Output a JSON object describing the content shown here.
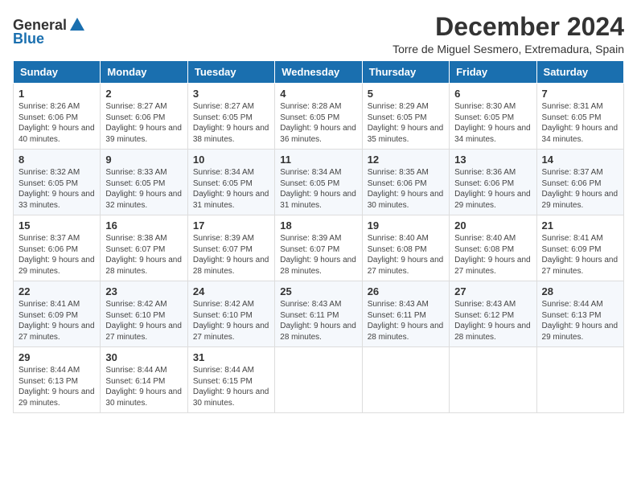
{
  "logo": {
    "general": "General",
    "blue": "Blue"
  },
  "title": {
    "month": "December 2024",
    "location": "Torre de Miguel Sesmero, Extremadura, Spain"
  },
  "headers": [
    "Sunday",
    "Monday",
    "Tuesday",
    "Wednesday",
    "Thursday",
    "Friday",
    "Saturday"
  ],
  "weeks": [
    [
      {
        "day": "1",
        "sunrise": "8:26 AM",
        "sunset": "6:06 PM",
        "daylight": "9 hours and 40 minutes."
      },
      {
        "day": "2",
        "sunrise": "8:27 AM",
        "sunset": "6:06 PM",
        "daylight": "9 hours and 39 minutes."
      },
      {
        "day": "3",
        "sunrise": "8:27 AM",
        "sunset": "6:05 PM",
        "daylight": "9 hours and 38 minutes."
      },
      {
        "day": "4",
        "sunrise": "8:28 AM",
        "sunset": "6:05 PM",
        "daylight": "9 hours and 36 minutes."
      },
      {
        "day": "5",
        "sunrise": "8:29 AM",
        "sunset": "6:05 PM",
        "daylight": "9 hours and 35 minutes."
      },
      {
        "day": "6",
        "sunrise": "8:30 AM",
        "sunset": "6:05 PM",
        "daylight": "9 hours and 34 minutes."
      },
      {
        "day": "7",
        "sunrise": "8:31 AM",
        "sunset": "6:05 PM",
        "daylight": "9 hours and 34 minutes."
      }
    ],
    [
      {
        "day": "8",
        "sunrise": "8:32 AM",
        "sunset": "6:05 PM",
        "daylight": "9 hours and 33 minutes."
      },
      {
        "day": "9",
        "sunrise": "8:33 AM",
        "sunset": "6:05 PM",
        "daylight": "9 hours and 32 minutes."
      },
      {
        "day": "10",
        "sunrise": "8:34 AM",
        "sunset": "6:05 PM",
        "daylight": "9 hours and 31 minutes."
      },
      {
        "day": "11",
        "sunrise": "8:34 AM",
        "sunset": "6:05 PM",
        "daylight": "9 hours and 31 minutes."
      },
      {
        "day": "12",
        "sunrise": "8:35 AM",
        "sunset": "6:06 PM",
        "daylight": "9 hours and 30 minutes."
      },
      {
        "day": "13",
        "sunrise": "8:36 AM",
        "sunset": "6:06 PM",
        "daylight": "9 hours and 29 minutes."
      },
      {
        "day": "14",
        "sunrise": "8:37 AM",
        "sunset": "6:06 PM",
        "daylight": "9 hours and 29 minutes."
      }
    ],
    [
      {
        "day": "15",
        "sunrise": "8:37 AM",
        "sunset": "6:06 PM",
        "daylight": "9 hours and 29 minutes."
      },
      {
        "day": "16",
        "sunrise": "8:38 AM",
        "sunset": "6:07 PM",
        "daylight": "9 hours and 28 minutes."
      },
      {
        "day": "17",
        "sunrise": "8:39 AM",
        "sunset": "6:07 PM",
        "daylight": "9 hours and 28 minutes."
      },
      {
        "day": "18",
        "sunrise": "8:39 AM",
        "sunset": "6:07 PM",
        "daylight": "9 hours and 28 minutes."
      },
      {
        "day": "19",
        "sunrise": "8:40 AM",
        "sunset": "6:08 PM",
        "daylight": "9 hours and 27 minutes."
      },
      {
        "day": "20",
        "sunrise": "8:40 AM",
        "sunset": "6:08 PM",
        "daylight": "9 hours and 27 minutes."
      },
      {
        "day": "21",
        "sunrise": "8:41 AM",
        "sunset": "6:09 PM",
        "daylight": "9 hours and 27 minutes."
      }
    ],
    [
      {
        "day": "22",
        "sunrise": "8:41 AM",
        "sunset": "6:09 PM",
        "daylight": "9 hours and 27 minutes."
      },
      {
        "day": "23",
        "sunrise": "8:42 AM",
        "sunset": "6:10 PM",
        "daylight": "9 hours and 27 minutes."
      },
      {
        "day": "24",
        "sunrise": "8:42 AM",
        "sunset": "6:10 PM",
        "daylight": "9 hours and 27 minutes."
      },
      {
        "day": "25",
        "sunrise": "8:43 AM",
        "sunset": "6:11 PM",
        "daylight": "9 hours and 28 minutes."
      },
      {
        "day": "26",
        "sunrise": "8:43 AM",
        "sunset": "6:11 PM",
        "daylight": "9 hours and 28 minutes."
      },
      {
        "day": "27",
        "sunrise": "8:43 AM",
        "sunset": "6:12 PM",
        "daylight": "9 hours and 28 minutes."
      },
      {
        "day": "28",
        "sunrise": "8:44 AM",
        "sunset": "6:13 PM",
        "daylight": "9 hours and 29 minutes."
      }
    ],
    [
      {
        "day": "29",
        "sunrise": "8:44 AM",
        "sunset": "6:13 PM",
        "daylight": "9 hours and 29 minutes."
      },
      {
        "day": "30",
        "sunrise": "8:44 AM",
        "sunset": "6:14 PM",
        "daylight": "9 hours and 30 minutes."
      },
      {
        "day": "31",
        "sunrise": "8:44 AM",
        "sunset": "6:15 PM",
        "daylight": "9 hours and 30 minutes."
      },
      null,
      null,
      null,
      null
    ]
  ]
}
